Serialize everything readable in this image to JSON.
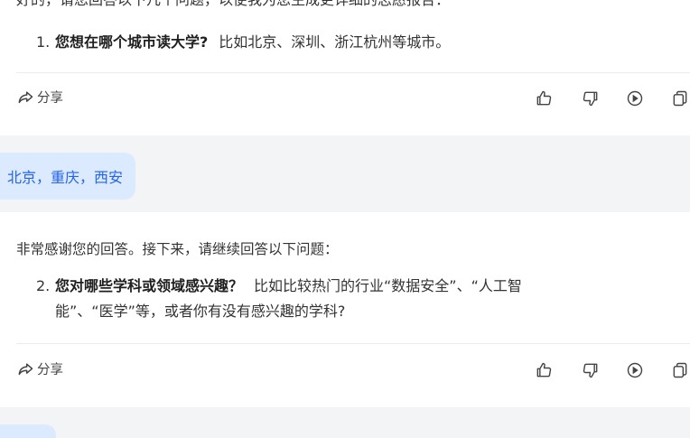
{
  "messages": {
    "assistant_1": {
      "intro": "好的，请您回答以下几个问题，以便我为您生成更详细的志愿报告：",
      "question": {
        "number": "1.",
        "bold": "您想在哪个城市读大学?",
        "text": "比如北京、深圳、浙江杭州等城市。"
      }
    },
    "user_1": "北京，重庆，西安",
    "assistant_2": {
      "intro": "非常感谢您的回答。接下来，请继续回答以下问题：",
      "question": {
        "number": "2.",
        "bold": "您对哪些学科或领域感兴趣？",
        "text_line1": "比如比较热门的行业“数据安全”、“人工智",
        "text_line2": "能”、“医学”等，或者你有没有感兴趣的学科?"
      }
    }
  },
  "actions": {
    "share_label": "分享",
    "icons": [
      "thumbs-up-icon",
      "thumbs-down-icon",
      "play-icon",
      "copy-icon"
    ]
  },
  "colors": {
    "page_bg": "#f3f4f6",
    "card_bg": "#ffffff",
    "user_bubble_bg": "#dbeafe",
    "user_text": "#2563eb"
  }
}
